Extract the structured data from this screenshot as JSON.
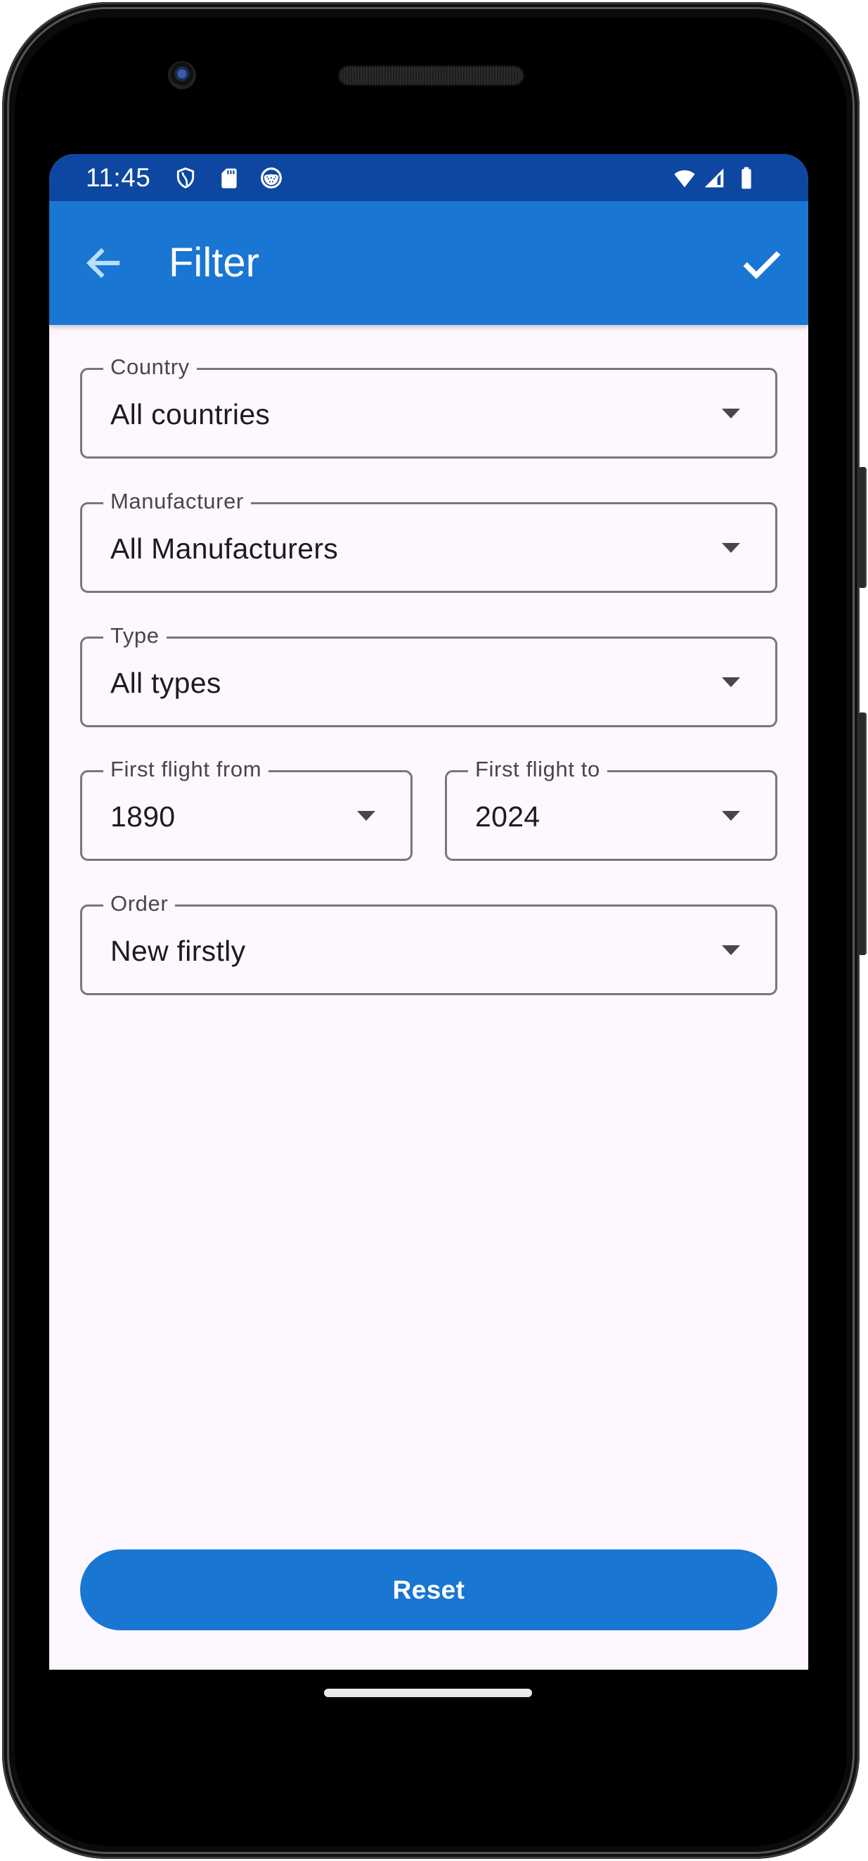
{
  "status_bar": {
    "time": "11:45",
    "left_icons": [
      "shield-icon",
      "sd-card-icon",
      "privacy-dots-icon"
    ],
    "right_icons": [
      "wifi-icon",
      "cell-signal-icon",
      "battery-icon"
    ]
  },
  "app_bar": {
    "title": "Filter",
    "back_icon": "arrow-back-icon",
    "confirm_icon": "check-icon"
  },
  "filters": {
    "country": {
      "label": "Country",
      "value": "All countries"
    },
    "manufacturer": {
      "label": "Manufacturer",
      "value": "All Manufacturers"
    },
    "type": {
      "label": "Type",
      "value": "All types"
    },
    "first_flight_from": {
      "label": "First flight from",
      "value": "1890"
    },
    "first_flight_to": {
      "label": "First flight to",
      "value": "2024"
    },
    "order": {
      "label": "Order",
      "value": "New firstly"
    }
  },
  "actions": {
    "reset_label": "Reset"
  },
  "colors": {
    "status_bar": "#0D47A1",
    "app_bar": "#1976D2",
    "primary_button": "#1976D2",
    "surface": "#FEF7FF",
    "outline": "#79747E"
  }
}
